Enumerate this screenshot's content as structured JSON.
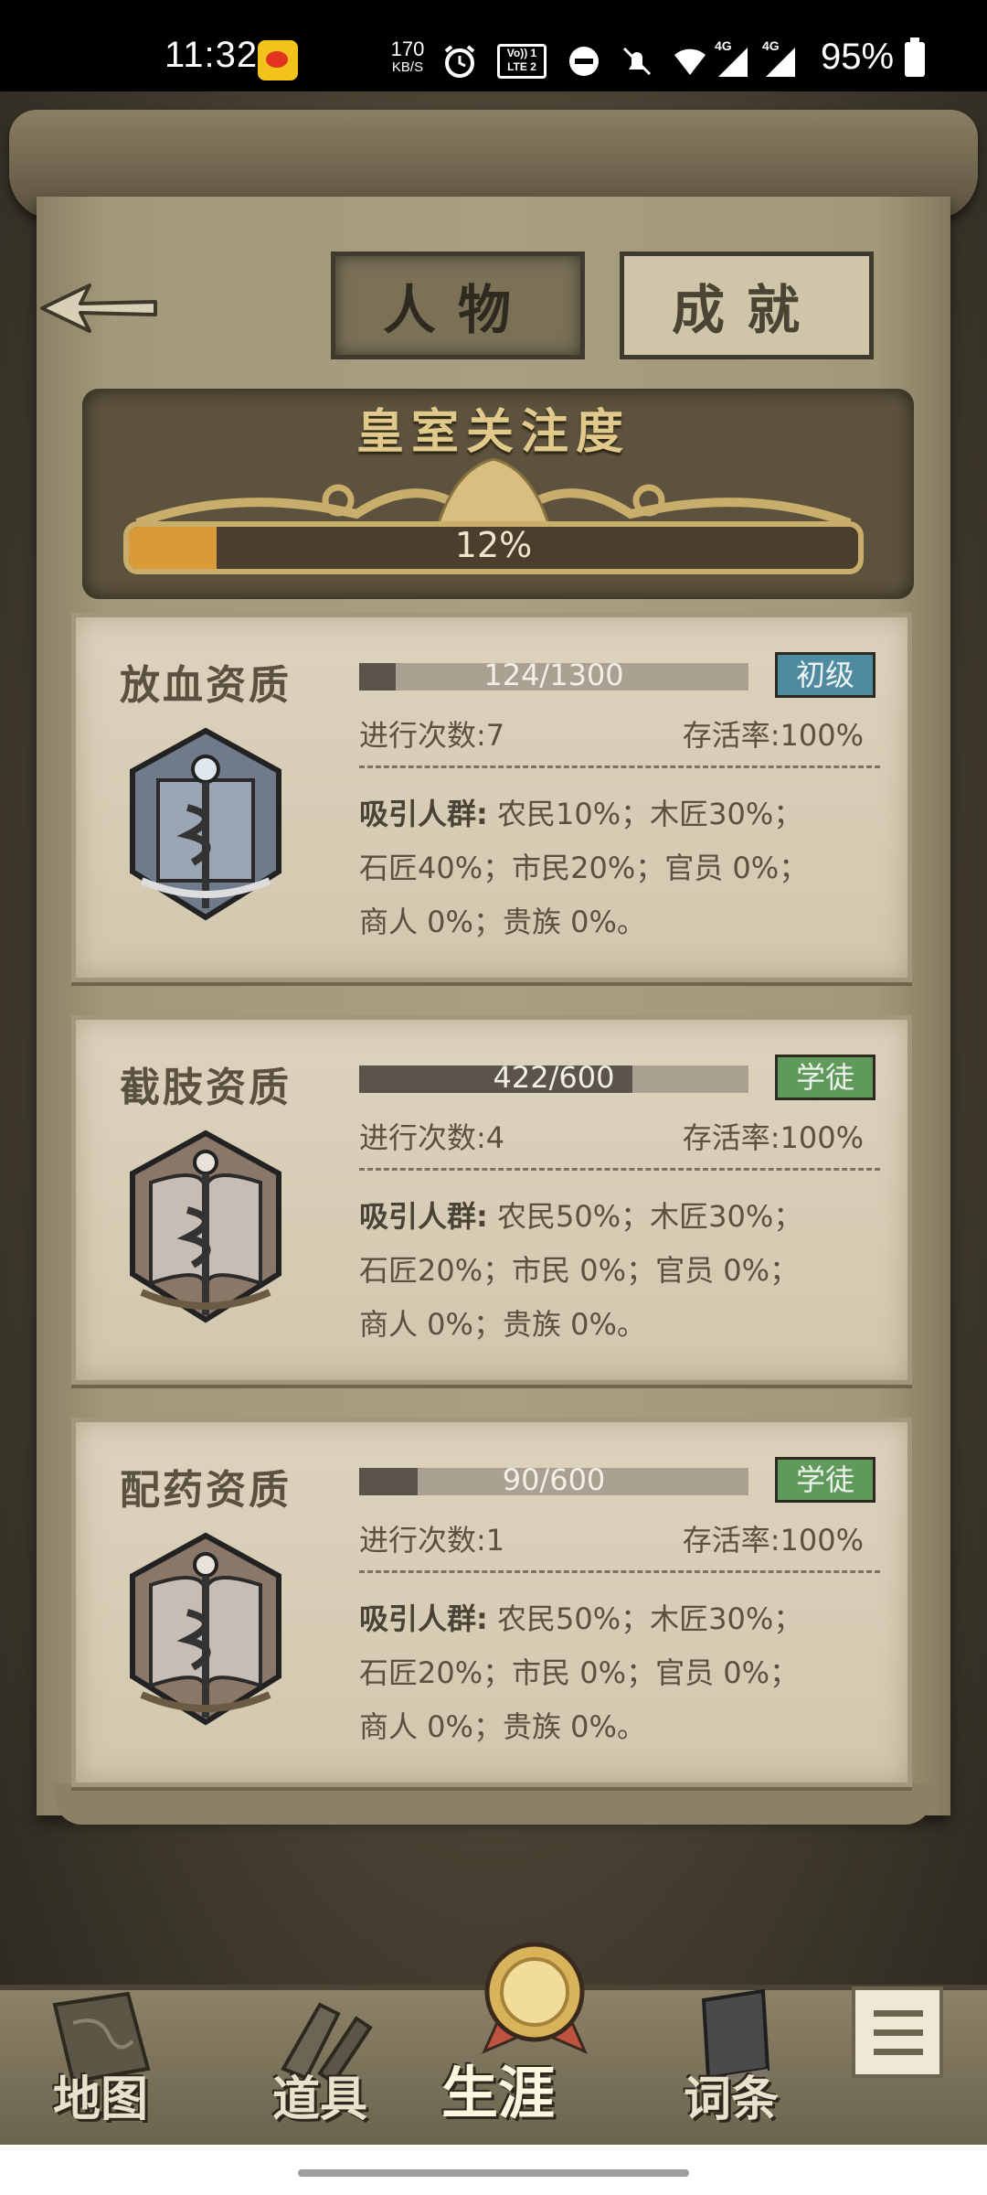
{
  "status_bar": {
    "time": "11:32",
    "net_speed_value": "170",
    "net_speed_unit": "KB/S",
    "volte_label": "Vo)) 1 LTE 2",
    "signal1_label": "4G",
    "signal2_label": "4G",
    "battery_percent": "95%"
  },
  "tabs": {
    "person": "人物",
    "achievement": "成就",
    "active": "person"
  },
  "royal": {
    "title": "皇室关注度",
    "percent_text": "12%",
    "fill_fraction": 0.12
  },
  "cards": [
    {
      "title": "放血资质",
      "xp_text": "124/1300",
      "xp_fraction": 0.095,
      "badge": "初级",
      "badge_color": "#4f8ba0",
      "runs": "进行次数:7",
      "survival": "存活率:100%",
      "attract_label": "吸引人群:",
      "line1": "农民10%；木匠30%；",
      "line2": "石匠40%；市民20%；官员 0%；",
      "line3": "商人 0%；贵族 0%。"
    },
    {
      "title": "截肢资质",
      "xp_text": "422/600",
      "xp_fraction": 0.703,
      "badge": "学徒",
      "badge_color": "#5f9a5a",
      "runs": "进行次数:4",
      "survival": "存活率:100%",
      "attract_label": "吸引人群:",
      "line1": "农民50%；木匠30%；",
      "line2": "石匠20%；市民 0%；官员 0%；",
      "line3": "商人 0%；贵族 0%。"
    },
    {
      "title": "配药资质",
      "xp_text": "90/600",
      "xp_fraction": 0.15,
      "badge": "学徒",
      "badge_color": "#5f9a5a",
      "runs": "进行次数:1",
      "survival": "存活率:100%",
      "attract_label": "吸引人群:",
      "line1": "农民50%；木匠30%；",
      "line2": "石匠20%；市民 0%；官员 0%；",
      "line3": "商人 0%；贵族 0%。"
    }
  ],
  "nav": {
    "map": "地图",
    "items": "道具",
    "career": "生涯",
    "entries": "词条",
    "active": "career"
  },
  "icons": {
    "back": "back-arrow-icon",
    "menu": "menu-icon",
    "medal": "medal-icon"
  }
}
